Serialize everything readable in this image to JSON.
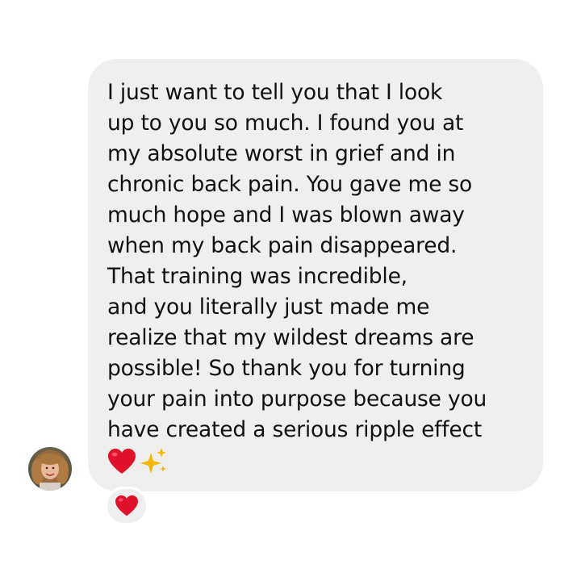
{
  "message": {
    "lines": [
      "I just want to tell you that I look",
      "up to you so much. I found you at",
      "my absolute worst in grief and in",
      "chronic back pain. You gave me so",
      "much hope and I was blown away",
      "when my back pain disappeared.",
      "That training was incredible,",
      "and you literally just made me",
      "realize that my wildest dreams are",
      "possible! So thank you for turning",
      "your pain into purpose because you",
      "have created a serious ripple effect"
    ],
    "emojis": [
      "heart-emoji",
      "sparkles-emoji"
    ]
  },
  "sender": {
    "avatar_icon": "avatar-photo-icon"
  },
  "reaction": {
    "icon": "heart-emoji"
  },
  "colors": {
    "bubble": "#efefef",
    "text": "#111111",
    "heart": "#e0112b",
    "sparkles": "#f5b800"
  }
}
